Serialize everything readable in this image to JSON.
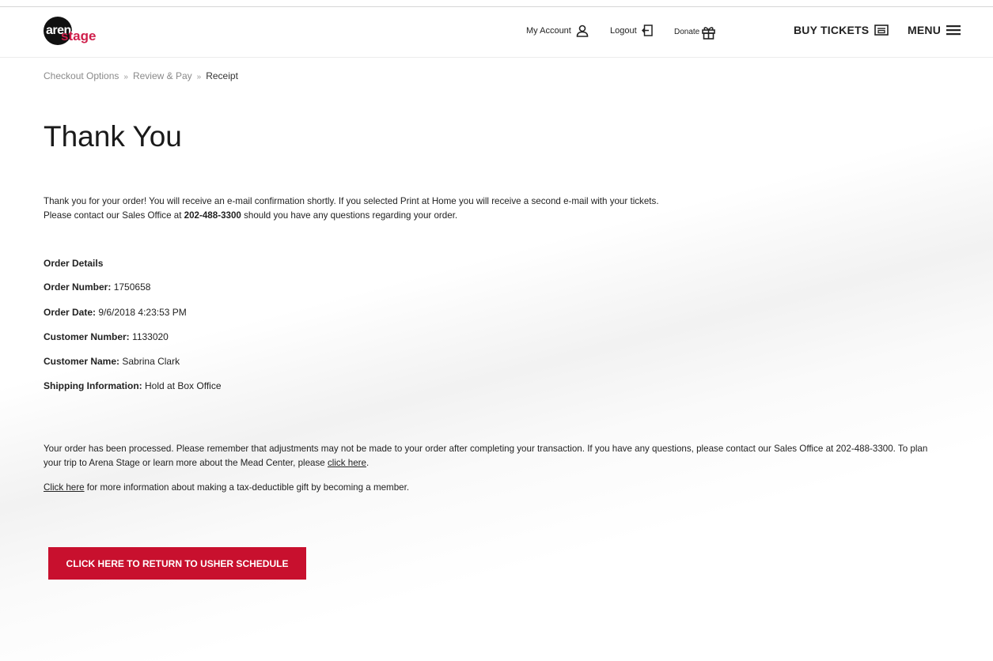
{
  "header": {
    "logo": {
      "word1": "arena",
      "word2": "stage"
    },
    "my_account": "My Account",
    "logout": "Logout",
    "donate": "Donate",
    "buy_tickets": "BUY TICKETS",
    "menu": "MENU"
  },
  "breadcrumb": {
    "step1": "Checkout Options",
    "step2": "Review & Pay",
    "step3": "Receipt",
    "separator": "»"
  },
  "page_title": "Thank You",
  "intro": {
    "line1": "Thank you for your order! You will receive an e-mail confirmation shortly. If you selected Print at Home you will receive a second e-mail with your tickets.",
    "line2_before": "Please contact our Sales Office at ",
    "phone": "202-488-3300",
    "line2_after": " should you have any questions regarding your order."
  },
  "order": {
    "heading": "Order Details",
    "number_label": "Order Number:",
    "number": "1750658",
    "date_label": "Order Date:",
    "date": "9/6/2018 4:23:53 PM",
    "customer_number_label": "Customer Number:",
    "customer_number": "1133020",
    "customer_name_label": "Customer Name:",
    "customer_name": "Sabrina Clark",
    "shipping_label": "Shipping Information:",
    "shipping": "Hold at Box Office"
  },
  "notice": {
    "text_before": "Your order has been processed. Please remember that adjustments may not be made to your order after completing your transaction. If you have any questions, please contact our Sales Office at 202-488-3300. To plan your trip to Arena Stage or learn more about the Mead Center, please ",
    "link": "click here",
    "text_after": "."
  },
  "gift": {
    "link": "Click here",
    "text": " for more information about making a tax-deductible gift by becoming a member."
  },
  "cta_label": "CLICK HERE TO RETURN TO USHER SCHEDULE",
  "colors": {
    "brand_red": "#c8102e",
    "logo_pink": "#cf1f4b"
  }
}
